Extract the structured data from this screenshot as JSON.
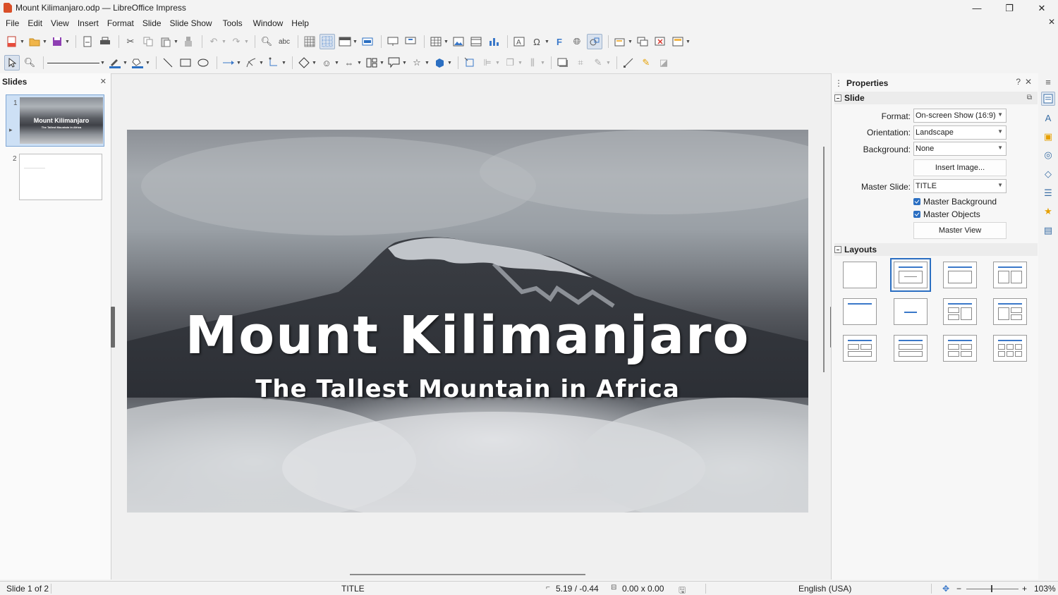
{
  "window": {
    "title": "Mount Kilimanjaro.odp — LibreOffice Impress",
    "minimize": "—",
    "maximize": "❐",
    "close": "✕"
  },
  "menu": [
    "File",
    "Edit",
    "View",
    "Insert",
    "Format",
    "Slide",
    "Slide Show",
    "Tools",
    "Window",
    "Help"
  ],
  "document_close": "✕",
  "slides_pane": {
    "title": "Slides",
    "close": "✕",
    "slide1_number": "1",
    "slide1_title": "Mount Kilimanjaro",
    "slide1_subtitle": "The Tallest Mountain in Africa",
    "slide2_number": "2"
  },
  "slide": {
    "title": "Mount Kilimanjaro",
    "subtitle": "The Tallest Mountain in Africa"
  },
  "properties": {
    "title": "Properties",
    "help": "?",
    "close": "✕",
    "slide_section": "Slide",
    "format_label": "Format:",
    "format_value": "On-screen Show (16:9)",
    "orientation_label": "Orientation:",
    "orientation_value": "Landscape",
    "background_label": "Background:",
    "background_value": "None",
    "insert_image": "Insert Image...",
    "master_slide_label": "Master Slide:",
    "master_slide_value": "TITLE",
    "master_background": "Master Background",
    "master_objects": "Master Objects",
    "master_view": "Master View",
    "layouts_section": "Layouts"
  },
  "status": {
    "slide_info": "Slide 1 of 2",
    "master": "TITLE",
    "position": "5.19 / -0.44",
    "size": "0.00 x 0.00",
    "language": "English (USA)",
    "zoom_minus": "−",
    "zoom_plus": "+",
    "zoom": "103%"
  }
}
